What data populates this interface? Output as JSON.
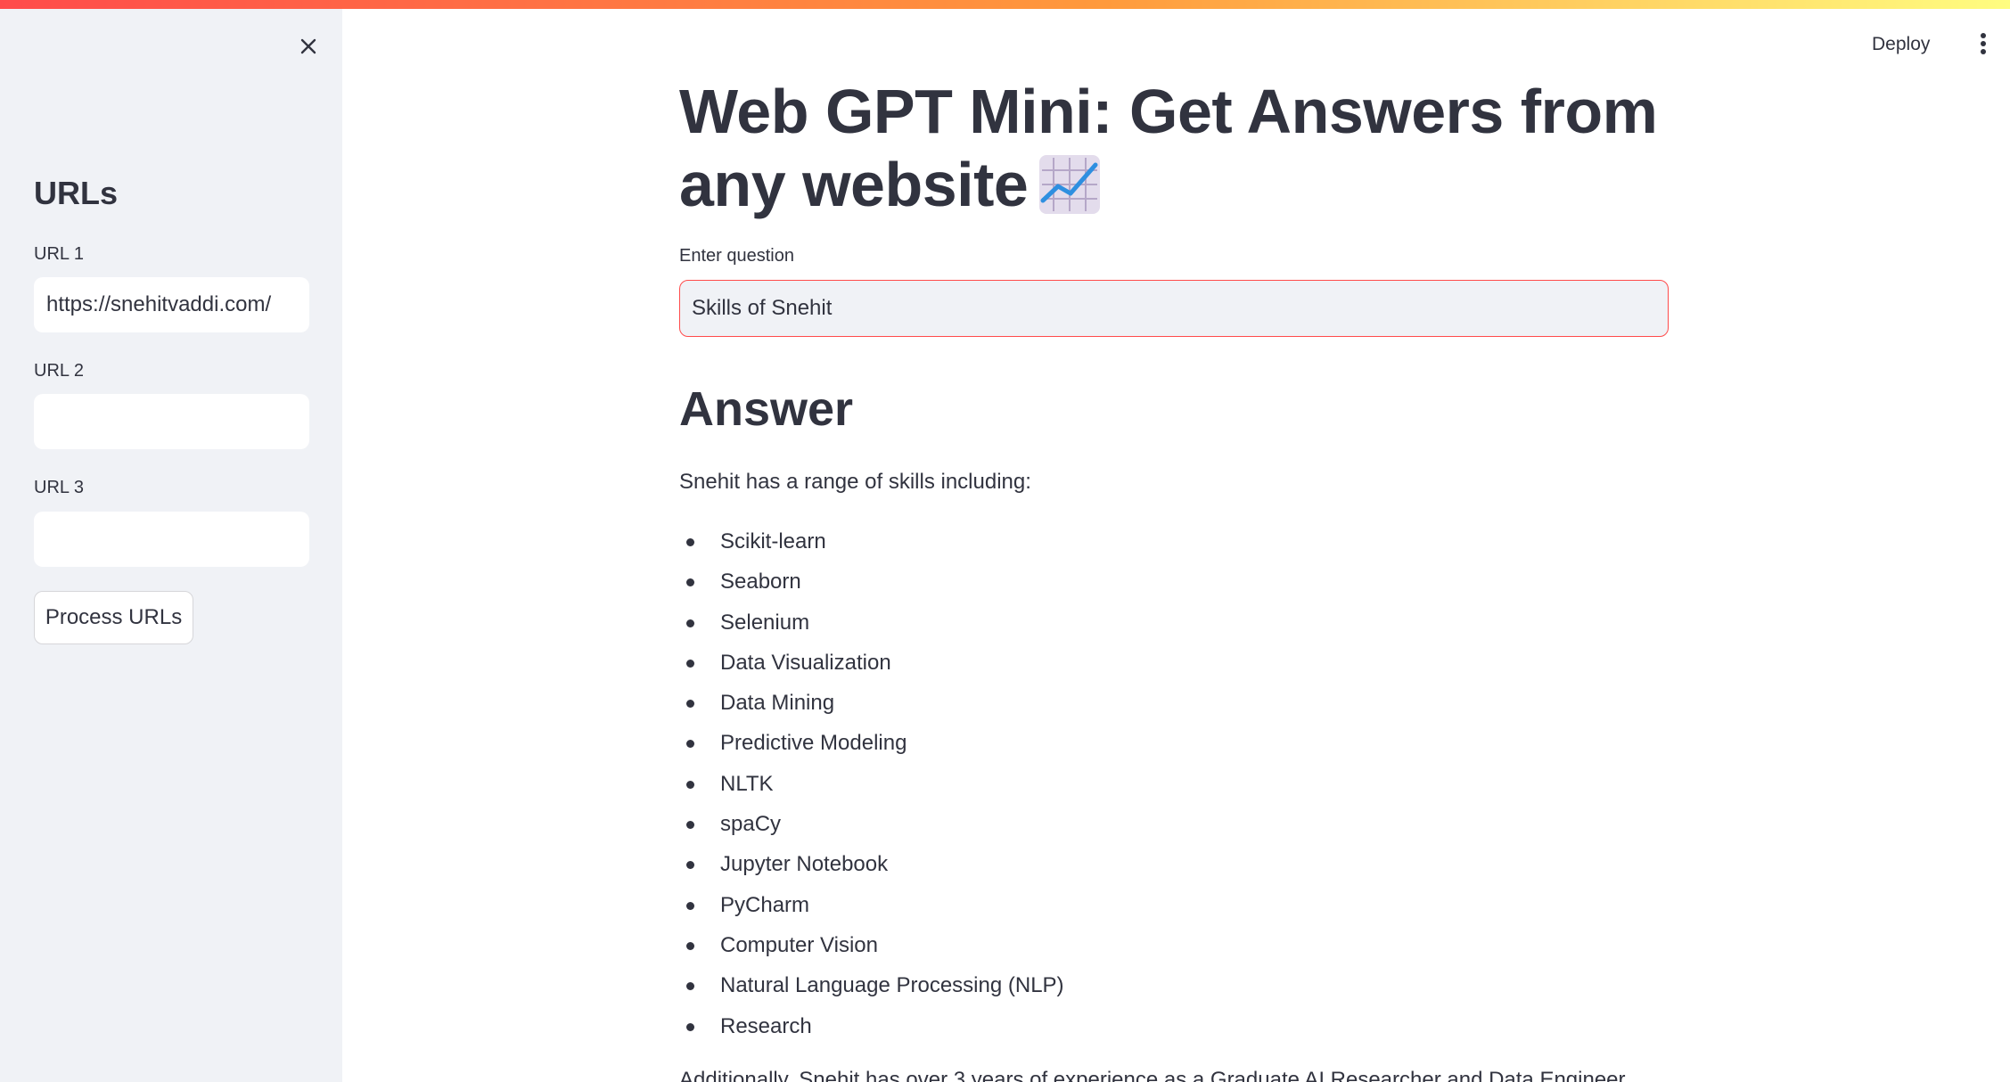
{
  "sidebar": {
    "heading": "URLs",
    "url_fields": [
      {
        "label": "URL 1",
        "value": "https://snehitvaddi.com/"
      },
      {
        "label": "URL 2",
        "value": ""
      },
      {
        "label": "URL 3",
        "value": ""
      }
    ],
    "process_button_label": "Process URLs",
    "close_icon": "close-icon"
  },
  "header": {
    "deploy_label": "Deploy",
    "menu_icon": "vertical-ellipsis-icon"
  },
  "main": {
    "title": "Web GPT Mini: Get Answers from any website",
    "title_icon": "chart-increasing-icon",
    "question_label": "Enter question",
    "question_value": "Skills of Snehit",
    "answer_heading": "Answer",
    "answer_intro": "Snehit has a range of skills including:",
    "skills": [
      "Scikit-learn",
      "Seaborn",
      "Selenium",
      "Data Visualization",
      "Data Mining",
      "Predictive Modeling",
      "NLTK",
      "spaCy",
      "Jupyter Notebook",
      "PyCharm",
      "Computer Vision",
      "Natural Language Processing (NLP)",
      "Research"
    ],
    "answer_footer": "Additionally, Snehit has over 3 years of experience as a Graduate AI Researcher and Data Engineer."
  },
  "colors": {
    "accent": "#ff4b4b",
    "sidebar_bg": "#f0f2f6",
    "text": "#31333f"
  }
}
